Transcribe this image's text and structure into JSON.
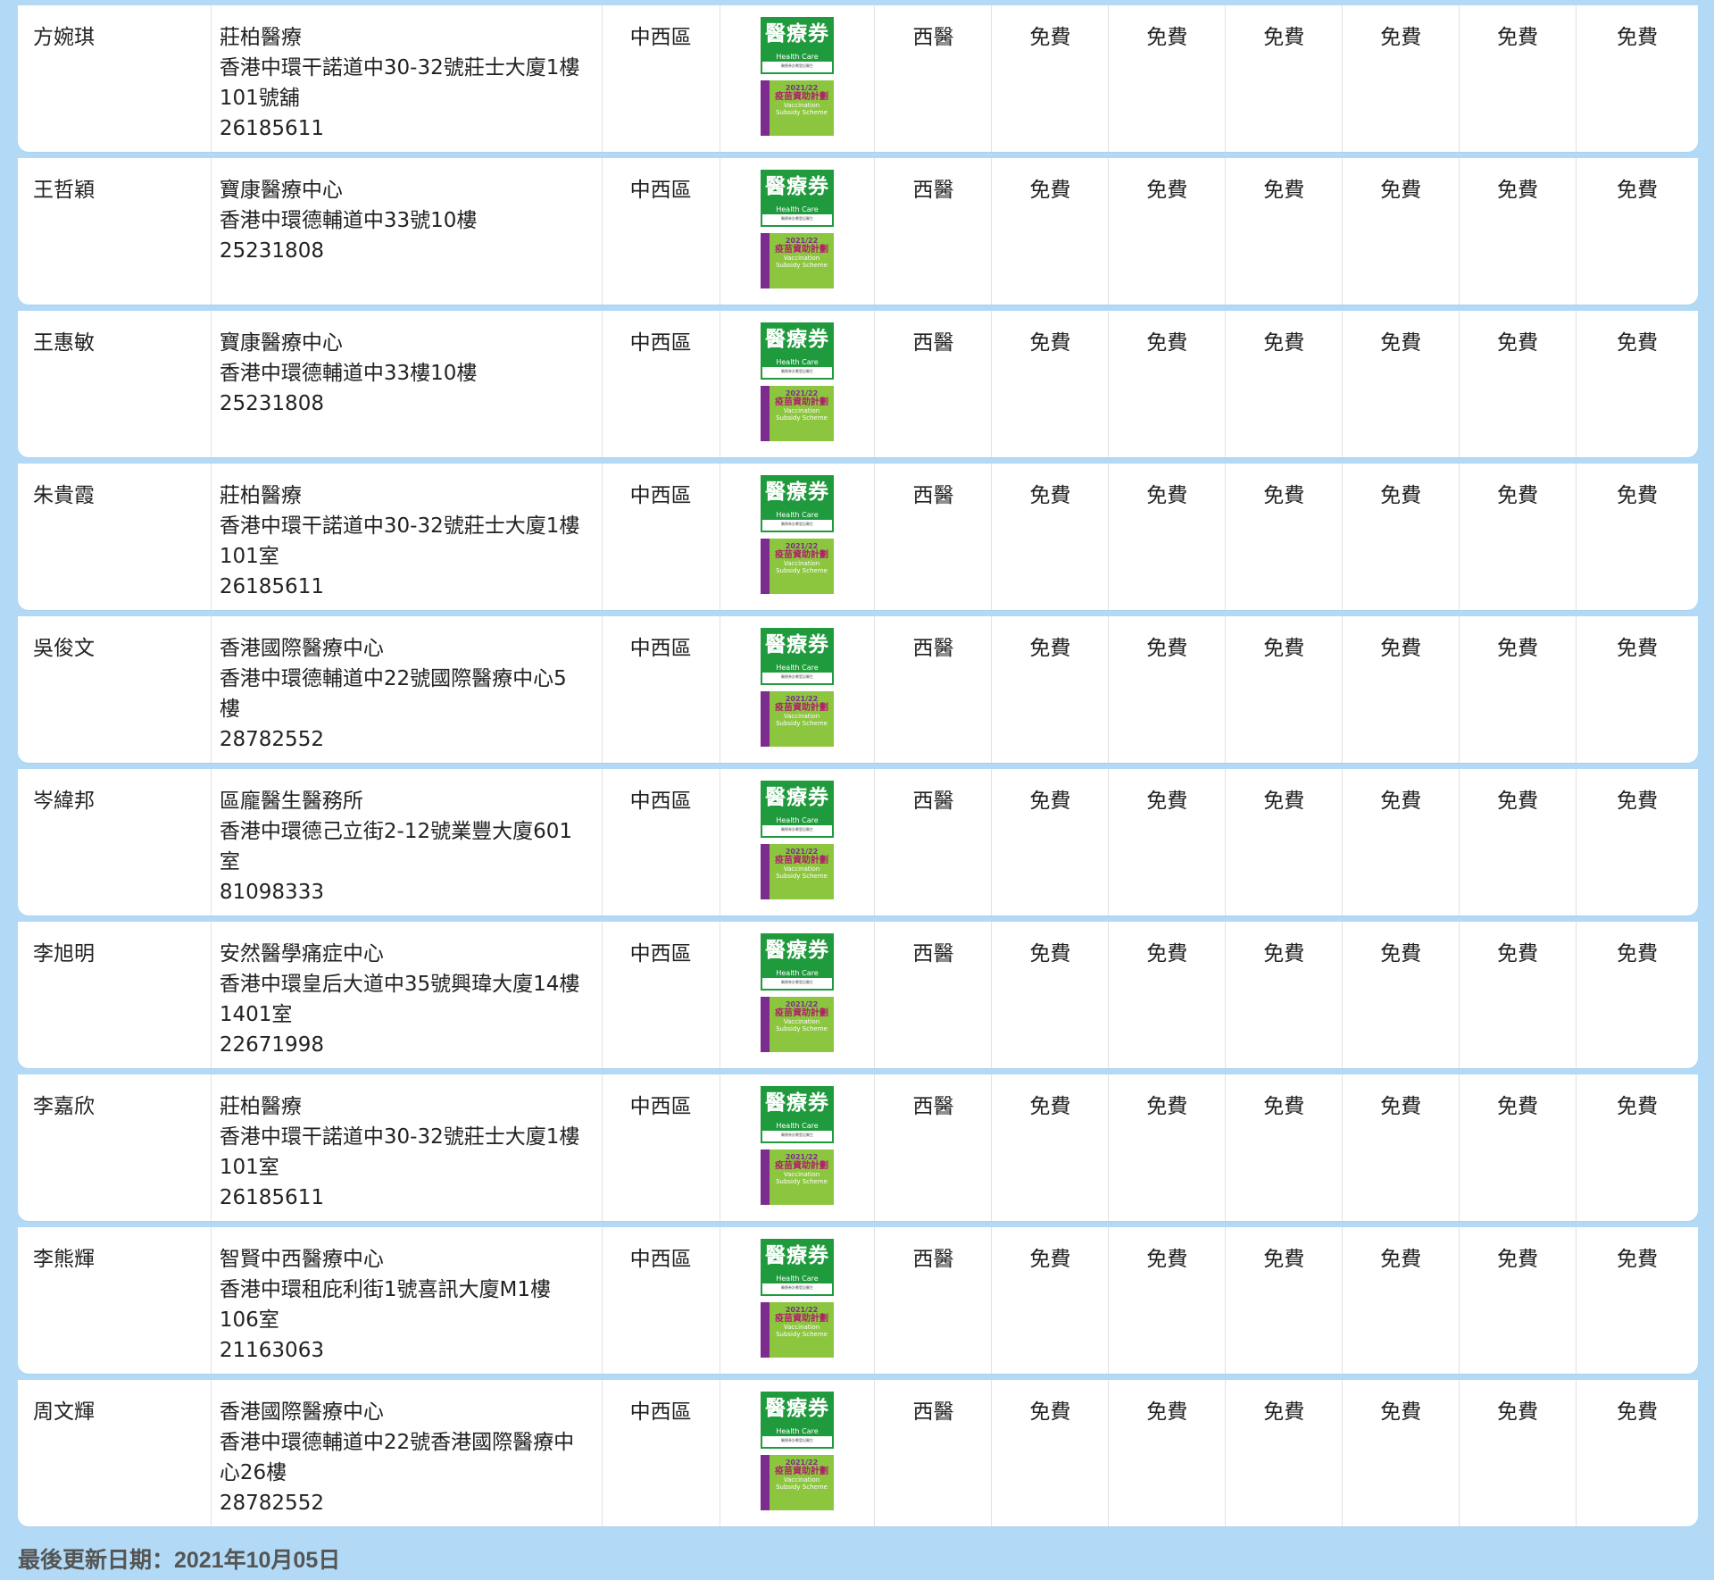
{
  "badges": {
    "hcv_title": "醫療券",
    "hcv_sub": "Health Care Voucher",
    "hcv_fine": "醫療券計劃登記醫生",
    "vss_year": "2021/22",
    "vss_title": "疫苗資助計劃",
    "vss_en1": "Vaccination",
    "vss_en2": "Subsidy Scheme"
  },
  "doctors": [
    {
      "name": "方婉琪",
      "clinic": [
        "莊柏醫療",
        "香港中環干諾道中30-32號莊士大廈1樓",
        "101號舖",
        "26185611"
      ],
      "district": "中西區",
      "type": "西醫",
      "fees": [
        "免費",
        "免費",
        "免費",
        "免費",
        "免費",
        "免費"
      ]
    },
    {
      "name": "王哲穎",
      "clinic": [
        "寶康醫療中心",
        "香港中環德輔道中33號10樓",
        "25231808"
      ],
      "district": "中西區",
      "type": "西醫",
      "fees": [
        "免費",
        "免費",
        "免費",
        "免費",
        "免費",
        "免費"
      ]
    },
    {
      "name": "王惠敏",
      "clinic": [
        "寶康醫療中心",
        "香港中環德輔道中33樓10樓",
        "25231808"
      ],
      "district": "中西區",
      "type": "西醫",
      "fees": [
        "免費",
        "免費",
        "免費",
        "免費",
        "免費",
        "免費"
      ]
    },
    {
      "name": "朱貴霞",
      "clinic": [
        "莊柏醫療",
        "香港中環干諾道中30-32號莊士大廈1樓",
        "101室",
        "26185611"
      ],
      "district": "中西區",
      "type": "西醫",
      "fees": [
        "免費",
        "免費",
        "免費",
        "免費",
        "免費",
        "免費"
      ]
    },
    {
      "name": "吳俊文",
      "clinic": [
        "香港國際醫療中心",
        "香港中環德輔道中22號國際醫療中心5",
        "樓",
        "28782552"
      ],
      "district": "中西區",
      "type": "西醫",
      "fees": [
        "免費",
        "免費",
        "免費",
        "免費",
        "免費",
        "免費"
      ]
    },
    {
      "name": "岑緯邦",
      "clinic": [
        "區龐醫生醫務所",
        "香港中環德己立街2-12號業豐大廈601",
        "室",
        "81098333"
      ],
      "district": "中西區",
      "type": "西醫",
      "fees": [
        "免費",
        "免費",
        "免費",
        "免費",
        "免費",
        "免費"
      ]
    },
    {
      "name": "李旭明",
      "clinic": [
        "安然醫學痛症中心",
        "香港中環皇后大道中35號興瑋大廈14樓",
        "1401室",
        "22671998"
      ],
      "district": "中西區",
      "type": "西醫",
      "fees": [
        "免費",
        "免費",
        "免費",
        "免費",
        "免費",
        "免費"
      ]
    },
    {
      "name": "李嘉欣",
      "clinic": [
        "莊柏醫療",
        "香港中環干諾道中30-32號莊士大廈1樓",
        "101室",
        "26185611"
      ],
      "district": "中西區",
      "type": "西醫",
      "fees": [
        "免費",
        "免費",
        "免費",
        "免費",
        "免費",
        "免費"
      ]
    },
    {
      "name": "李熊輝",
      "clinic": [
        "智賢中西醫療中心",
        "香港中環租庇利街1號喜訊大廈M1樓",
        "106室",
        "21163063"
      ],
      "district": "中西區",
      "type": "西醫",
      "fees": [
        "免費",
        "免費",
        "免費",
        "免費",
        "免費",
        "免費"
      ]
    },
    {
      "name": "周文輝",
      "clinic": [
        "香港國際醫療中心",
        "香港中環德輔道中22號香港國際醫療中",
        "心26樓",
        "28782552"
      ],
      "district": "中西區",
      "type": "西醫",
      "fees": [
        "免費",
        "免費",
        "免費",
        "免費",
        "免費",
        "免費"
      ]
    }
  ],
  "footer": {
    "last_updated": "最後更新日期：2021年10月05日"
  },
  "colors": {
    "background": "#b2daf6",
    "voucher_green": "#1f9a3c",
    "vaccine_green": "#8cc63f",
    "vaccine_purple": "#7b2c8e"
  }
}
